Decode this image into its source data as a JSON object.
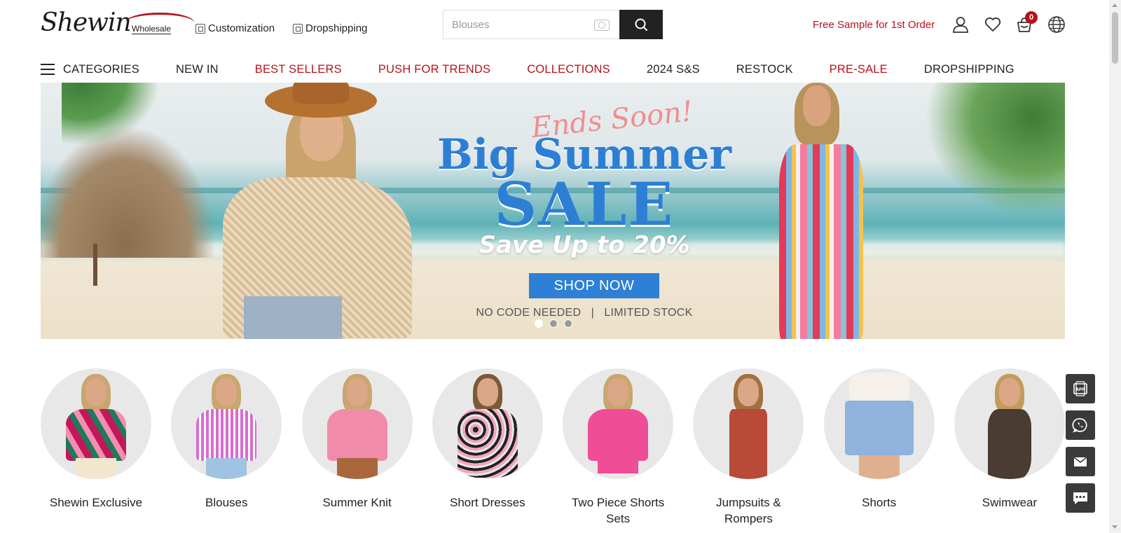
{
  "header": {
    "logo_text": "Shewin",
    "logo_sub": "Wholesale",
    "links": [
      "Customization",
      "Dropshipping"
    ],
    "search_placeholder": "Blouses",
    "free_sample": "Free Sample for 1st Order",
    "cart_count": "0"
  },
  "nav": {
    "categories_label": "CATEGORIES",
    "items": [
      {
        "label": "NEW IN",
        "color": "#222222"
      },
      {
        "label": "BEST SELLERS",
        "color": "#b5121b"
      },
      {
        "label": "PUSH FOR TRENDS",
        "color": "#b5121b"
      },
      {
        "label": "COLLECTIONS",
        "color": "#b5121b"
      },
      {
        "label": "2024 S&S",
        "color": "#222222"
      },
      {
        "label": "RESTOCK",
        "color": "#222222"
      },
      {
        "label": "PRE-SALE",
        "color": "#b5121b"
      },
      {
        "label": "DROPSHIPPING",
        "color": "#222222"
      }
    ]
  },
  "banner": {
    "tagline": "Ends Soon!",
    "headline": "Big Summer",
    "sale": "SALE",
    "save": "Save Up to 20%",
    "cta": "SHOP NOW",
    "note": "NO CODE NEEDED   |   LIMITED STOCK",
    "active_slide": 1,
    "slides_total": 3
  },
  "categories": [
    {
      "label": "Shewin Exclusive",
      "icon": "floral-blouse-icon"
    },
    {
      "label": "Blouses",
      "icon": "striped-blouse-icon"
    },
    {
      "label": "Summer Knit",
      "icon": "knit-top-icon"
    },
    {
      "label": "Short Dresses",
      "icon": "short-dress-icon"
    },
    {
      "label": "Two Piece Shorts Sets",
      "icon": "shorts-set-icon"
    },
    {
      "label": "Jumpsuits & Rompers",
      "icon": "jumpsuit-icon"
    },
    {
      "label": "Shorts",
      "icon": "denim-shorts-icon"
    },
    {
      "label": "Swimwear",
      "icon": "swimwear-icon"
    }
  ],
  "floating": [
    "app-icon",
    "whatsapp-icon",
    "email-icon",
    "chat-icon"
  ],
  "colors": {
    "accent_red": "#b5121b",
    "banner_blue": "#2c7fd4",
    "cta_blue": "#2e7fd6"
  }
}
